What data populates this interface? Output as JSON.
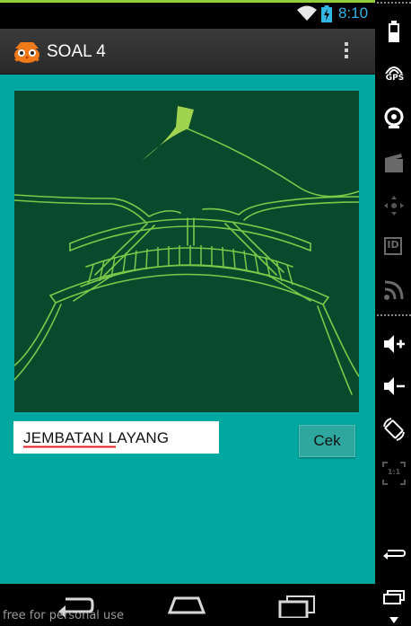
{
  "status_bar": {
    "time": "8:10"
  },
  "action_bar": {
    "title": "SOAL 4",
    "logo_icon": "owl-mascot-icon",
    "menu_icon": "overflow-menu-icon"
  },
  "puzzle": {
    "image": "flyover-bridge-kite-drawing"
  },
  "answer": {
    "value": "JEMBATAN LAYANG"
  },
  "check_button": {
    "label": "Cek"
  },
  "watermark": "free for personal use",
  "side_panel": {
    "gps_label": "GPS",
    "id_label": "ID",
    "scale_label": "1:1"
  },
  "colors": {
    "content_bg": "#00a89f",
    "image_bg": "#0a4a2c",
    "line_art": "#7cc94a",
    "status_time": "#33b5e5",
    "top_accent": "#8fcf3a"
  }
}
